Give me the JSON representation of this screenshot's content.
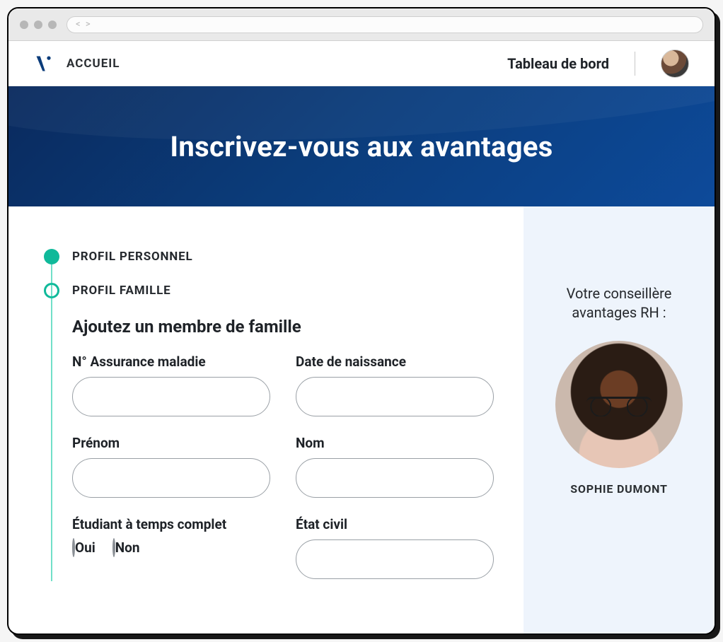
{
  "chrome": {
    "url_hint": "< >"
  },
  "nav": {
    "home_label": "ACCUEIL",
    "dashboard_label": "Tableau de bord"
  },
  "hero": {
    "title": "Inscrivez-vous aux avantages"
  },
  "steps": [
    {
      "label": "PROFIL PERSONNEL",
      "state": "done"
    },
    {
      "label": "PROFIL FAMILLE",
      "state": "current"
    }
  ],
  "form": {
    "section_title": "Ajoutez un membre de famille",
    "fields": {
      "health_insurance": {
        "label": "N° Assurance maladie",
        "value": ""
      },
      "birthdate": {
        "label": "Date de naissance",
        "value": ""
      },
      "firstname": {
        "label": "Prénom",
        "value": ""
      },
      "lastname": {
        "label": "Nom",
        "value": ""
      },
      "fulltime_student": {
        "label": "Étudiant à temps complet",
        "options": {
          "yes": "Oui",
          "no": "Non"
        },
        "value": null
      },
      "marital_status": {
        "label": "État civil",
        "value": ""
      }
    }
  },
  "aside": {
    "title": "Votre conseillère avantages RH :",
    "advisor_name": "SOPHIE DUMONT"
  }
}
